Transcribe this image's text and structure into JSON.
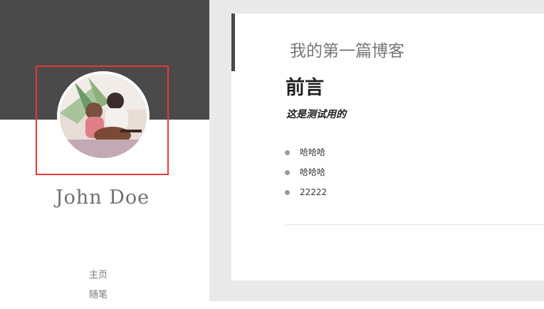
{
  "profile": {
    "name": "John Doe",
    "avatar_icon": "avatar-illustration"
  },
  "nav": {
    "items": [
      "主页",
      "随笔"
    ]
  },
  "post": {
    "title": "我的第一篇博客",
    "heading": "前言",
    "intro": "这是测试用的",
    "bullets": [
      "哈哈哈",
      "哈哈哈",
      "22222"
    ]
  },
  "colors": {
    "sidebar_dark": "#4a4a4a",
    "highlight": "#e53935",
    "content_bg": "#e9e9e9"
  }
}
